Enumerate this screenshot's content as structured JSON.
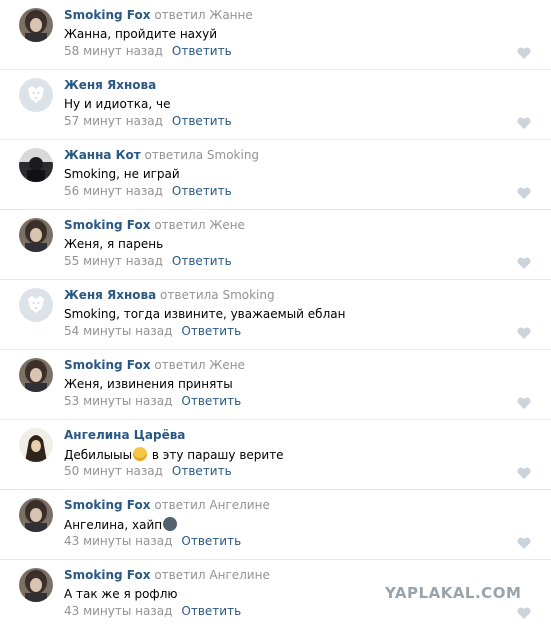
{
  "like_color": "#ccd3db",
  "watermark": "YAPLAKAL.COM",
  "comments": [
    {
      "avatar": "anime-avatar",
      "author": "Smoking Fox",
      "reply_to": "ответил Жанне",
      "text": "Жанна, пройдите нахуй",
      "time": "58 минут назад",
      "reply_label": "Ответить"
    },
    {
      "avatar": "default-dog-avatar",
      "author": "Женя Яхнова",
      "reply_to": "",
      "text": "Ну и идиотка, че",
      "time": "57 минут назад",
      "reply_label": "Ответить"
    },
    {
      "avatar": "dark-photo-avatar",
      "author": "Жанна Кот",
      "reply_to": "ответила Smoking",
      "text": "Smoking, не играй",
      "time": "56 минут назад",
      "reply_label": "Ответить"
    },
    {
      "avatar": "anime-avatar",
      "author": "Smoking Fox",
      "reply_to": "ответил Жене",
      "text": "Женя, я парень",
      "time": "55 минут назад",
      "reply_label": "Ответить"
    },
    {
      "avatar": "default-dog-avatar",
      "author": "Женя Яхнова",
      "reply_to": "ответила Smoking",
      "text": "Smoking, тогда извините, уважаемый еблан",
      "time": "54 минуты назад",
      "reply_label": "Ответить"
    },
    {
      "avatar": "anime-avatar",
      "author": "Smoking Fox",
      "reply_to": "ответил Жене",
      "text": "Женя, извинения приняты",
      "time": "53 минуты назад",
      "reply_label": "Ответить"
    },
    {
      "avatar": "hood-avatar",
      "author": "Ангелина Царёва",
      "reply_to": "",
      "text_before": "Дебилыыы",
      "emoji": "laughing-emoji",
      "text_after": " в эту парашу верите",
      "time": "50 минут назад",
      "reply_label": "Ответить"
    },
    {
      "avatar": "anime-avatar",
      "author": "Smoking Fox",
      "reply_to": "ответил Ангелине",
      "text_before": "Ангелина, хайп",
      "emoji": "dots-emoji",
      "text_after": "",
      "time": "43 минуты назад",
      "reply_label": "Ответить"
    },
    {
      "avatar": "anime-avatar",
      "author": "Smoking Fox",
      "reply_to": "ответил Ангелине",
      "text": "А так же я рофлю",
      "time": "43 минуты назад",
      "reply_label": "Ответить"
    }
  ]
}
